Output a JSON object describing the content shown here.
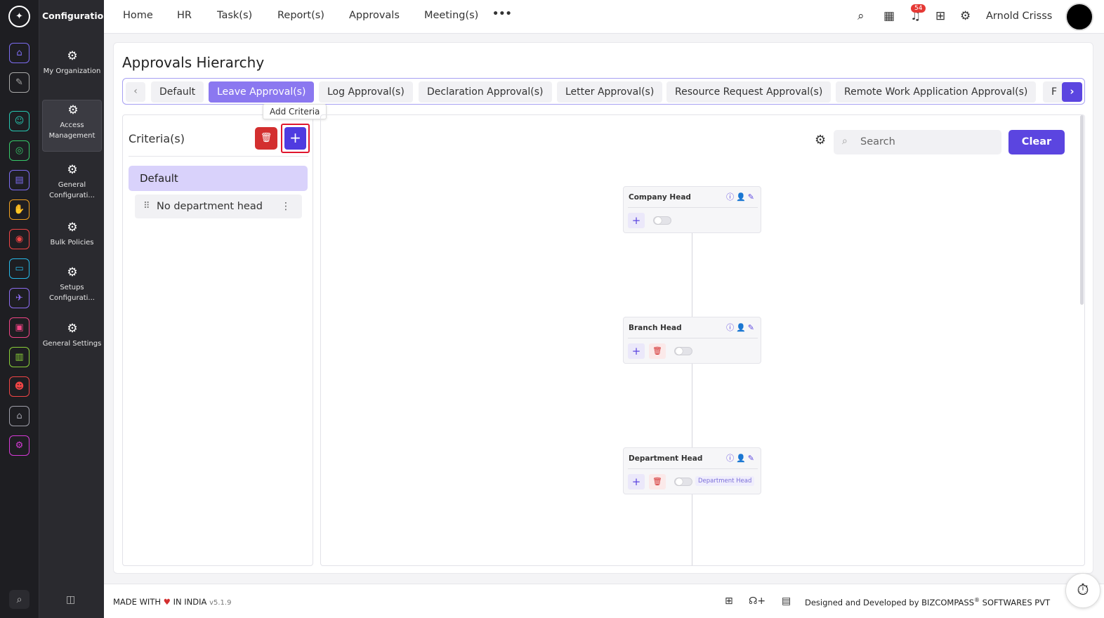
{
  "rail": {
    "items": [
      {
        "icon": "home-icon",
        "glyph": "⌂",
        "color": "#7c6cf0"
      },
      {
        "icon": "pin-icon",
        "glyph": "✎",
        "color": "#aaaaaa"
      },
      {
        "icon": "people-icon",
        "glyph": "☺",
        "color": "#26c6b0"
      },
      {
        "icon": "money-icon",
        "glyph": "◎",
        "color": "#36c96a"
      },
      {
        "icon": "briefcase-icon",
        "glyph": "▤",
        "color": "#7c6cf0"
      },
      {
        "icon": "hands-icon",
        "glyph": "✋",
        "color": "#f0a020"
      },
      {
        "icon": "target-icon",
        "glyph": "◉",
        "color": "#ef4545"
      },
      {
        "icon": "archive-icon",
        "glyph": "▭",
        "color": "#26b8e8"
      },
      {
        "icon": "plane-icon",
        "glyph": "✈",
        "color": "#8c6cf0"
      },
      {
        "icon": "monitor-icon",
        "glyph": "▣",
        "color": "#ef4585"
      },
      {
        "icon": "report-icon",
        "glyph": "▥",
        "color": "#8ad038"
      },
      {
        "icon": "user-badge-icon",
        "glyph": "☻",
        "color": "#ef4545"
      },
      {
        "icon": "building-icon",
        "glyph": "⌂",
        "color": "#9e9ea8"
      },
      {
        "icon": "gear-icon",
        "glyph": "⚙",
        "color": "#d63ad6"
      }
    ]
  },
  "submenu": {
    "title": "Configuration",
    "items": [
      {
        "label": "My Organization",
        "icon": "org-gear-icon"
      },
      {
        "label": "Access Management",
        "icon": "gear-icon"
      },
      {
        "label": "General Configurati...",
        "icon": "gear-icon"
      },
      {
        "label": "Bulk Policies",
        "icon": "document-gear-icon"
      },
      {
        "label": "Setups Configurati...",
        "icon": "gear-icon"
      },
      {
        "label": "General Settings",
        "icon": "org-gear-icon"
      }
    ]
  },
  "topbar": {
    "nav": [
      "Home",
      "HR",
      "Task(s)",
      "Report(s)",
      "Approvals",
      "Meeting(s)"
    ],
    "more": "•••",
    "notification_count": "54",
    "user_name": "Arnold Crisss"
  },
  "page": {
    "title": "Approvals Hierarchy",
    "tabs": [
      "Default",
      "Leave Approval(s)",
      "Log Approval(s)",
      "Declaration Approval(s)",
      "Letter Approval(s)",
      "Resource Request Approval(s)",
      "Remote Work Application Approval(s)",
      "F"
    ],
    "active_tab": "Leave Approval(s)"
  },
  "criteria": {
    "title": "Criteria(s)",
    "tooltip": "Add Criteria",
    "default_label": "Default",
    "items": [
      "No department head"
    ]
  },
  "hierarchy": {
    "search_placeholder": "Search",
    "clear_label": "Clear",
    "nodes": [
      {
        "title": "Company Head",
        "deletable": false,
        "tag": ""
      },
      {
        "title": "Branch Head",
        "deletable": true,
        "tag": ""
      },
      {
        "title": "Department Head",
        "deletable": true,
        "tag": "Department Head"
      }
    ]
  },
  "footer": {
    "made_prefix": "MADE WITH",
    "made_suffix": "IN INDIA",
    "version": "v5.1.9",
    "designed": "Designed and Developed by",
    "company": "BIZCOMPASS",
    "company_mark": "®",
    "company_suffix": " SOFTWARES PVT"
  }
}
